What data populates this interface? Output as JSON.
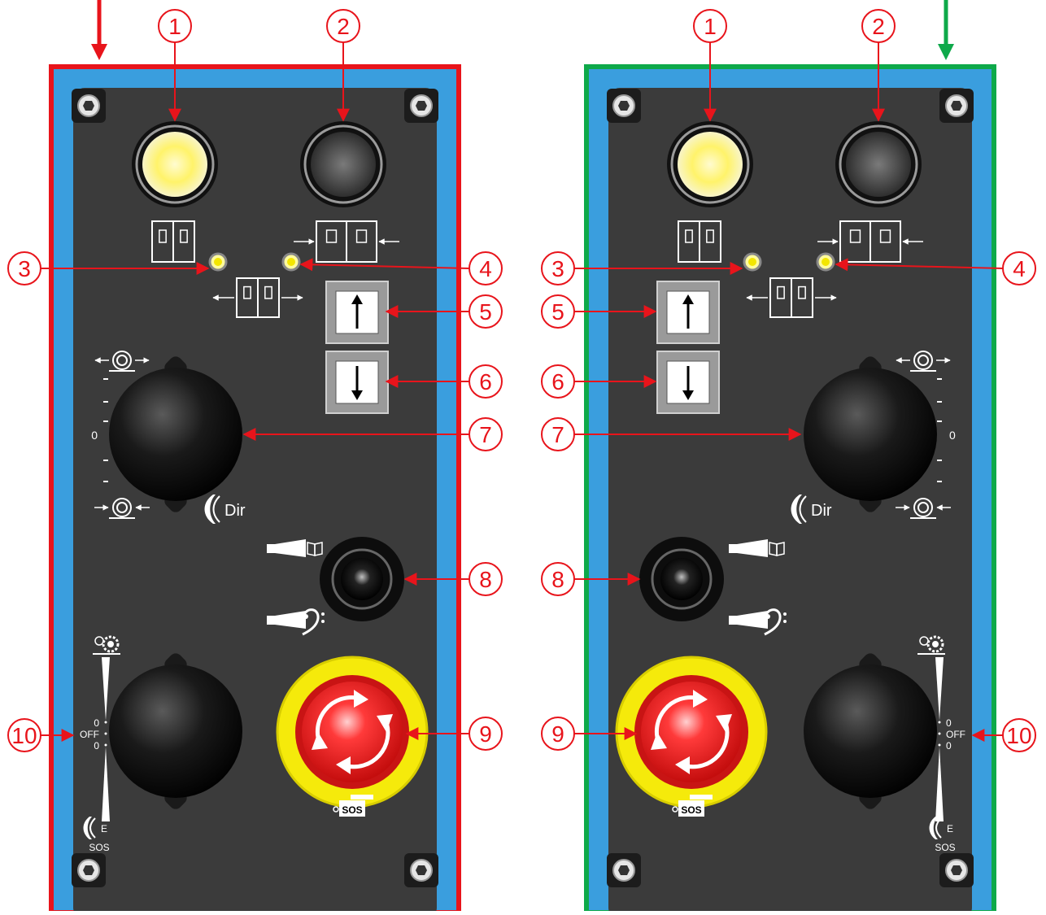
{
  "colors": {
    "left_frame": "#e8141b",
    "right_frame": "#0ea94a",
    "plate": "#3a9ede",
    "panel": "#3b3b3b",
    "callout": "#e8141b",
    "lamp_on": "#fff36a",
    "estop_ring": "#f5ea0b",
    "estop_button": "#e21b1b"
  },
  "callouts": [
    "1",
    "2",
    "3",
    "4",
    "5",
    "6",
    "7",
    "8",
    "9",
    "10"
  ],
  "labels": {
    "knob_zero": "0",
    "dir": "Dir",
    "switch_zero_top": "0",
    "switch_off": "OFF",
    "switch_zero_bottom": "0",
    "e_label": "E",
    "sos_switch": "SOS",
    "sos_estop": "SOS"
  },
  "panels": [
    {
      "id": "left",
      "side": "left",
      "frame_color": "red",
      "entry_arrow": "down"
    },
    {
      "id": "right",
      "side": "right",
      "frame_color": "green",
      "entry_arrow": "down"
    }
  ],
  "icons": {
    "lamp_1": "lit-lamp-icon",
    "lamp_2": "unlit-lamp-icon",
    "up_button": "arrow-up-icon",
    "down_button": "arrow-down-icon",
    "direction_knob": "rotary-knob-icon",
    "joystick": "joystick-icon",
    "e_stop": "emergency-stop-icon",
    "mode_switch": "rotary-switch-icon"
  }
}
